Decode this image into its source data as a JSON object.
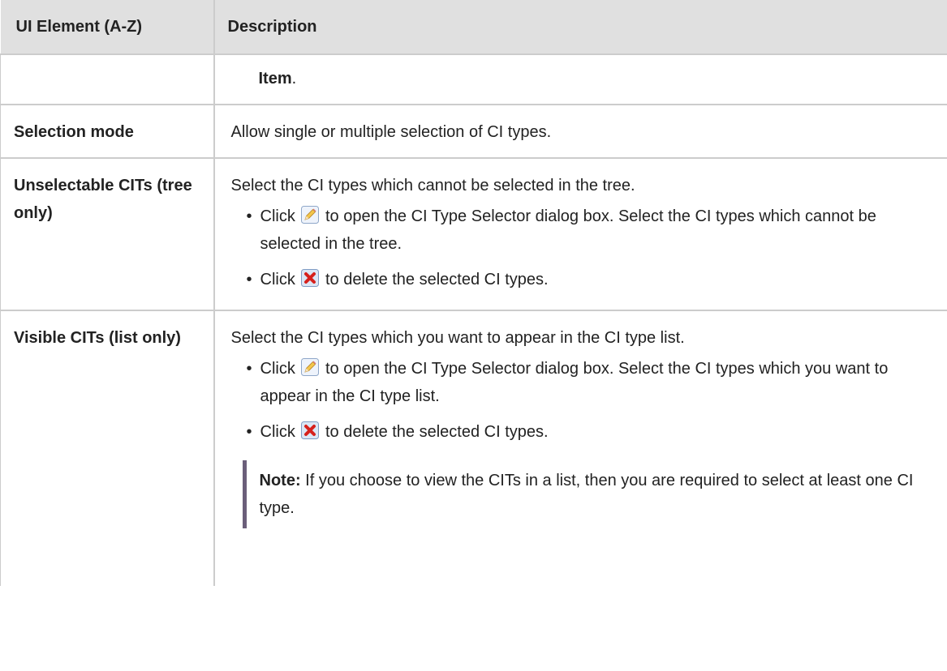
{
  "table": {
    "header": {
      "col1": "UI Element (A-Z)",
      "col2": "Description"
    },
    "continuation": {
      "item": "Item",
      "trail": "."
    },
    "rows": [
      {
        "name": "Selection mode",
        "desc": "Allow single or multiple selection of CI types."
      },
      {
        "name": "Unselectable CITs (tree only)",
        "desc": "Select the CI types which cannot be selected in the tree.",
        "bullets": [
          {
            "icon": "edit-pencil-icon",
            "pre": "Click",
            "post": "to open the CI Type Selector dialog box. Select the CI types which cannot be selected in the tree."
          },
          {
            "icon": "delete-x-icon",
            "pre": "Click",
            "post": "to delete the selected CI types."
          }
        ]
      },
      {
        "name": "Visible CITs (list only)",
        "desc": "Select the CI types which you want to appear in the CI type list.",
        "bullets": [
          {
            "icon": "edit-pencil-icon",
            "pre": "Click",
            "post": "to open the CI Type Selector dialog box. Select the CI types which you want to appear in the CI type list."
          },
          {
            "icon": "delete-x-icon",
            "pre": "Click",
            "post": "to delete the selected CI types."
          }
        ],
        "note": {
          "label": "Note:",
          "text": "If you choose to view the CITs in a list, then you are required to select at least one CI type."
        }
      }
    ]
  },
  "colors": {
    "header_bg": "#e0e0e0",
    "border": "#cccccc",
    "note_bar": "#6b5e7a",
    "text": "#222222"
  }
}
